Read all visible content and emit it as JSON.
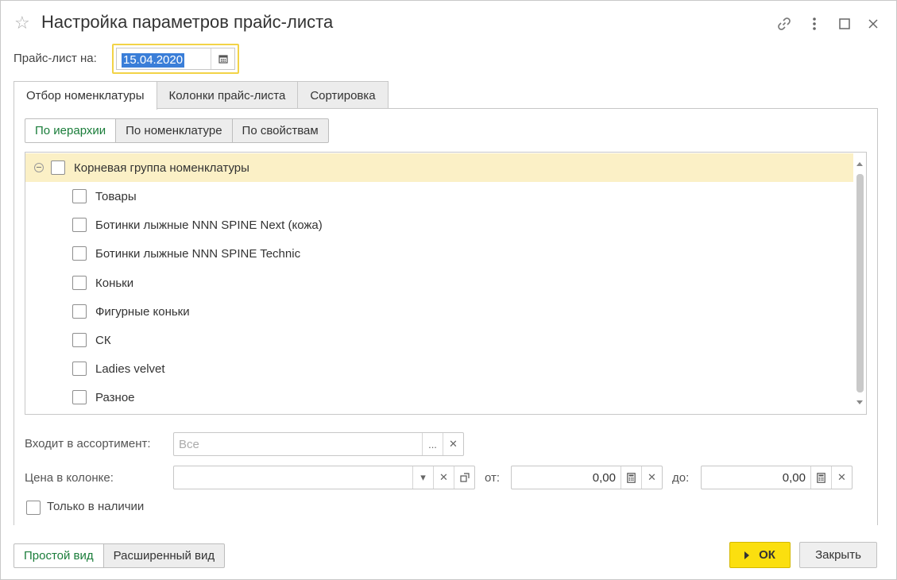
{
  "window": {
    "title": "Настройка параметров прайс-листа"
  },
  "price_date": {
    "label": "Прайс-лист на:",
    "value": "15.04.2020"
  },
  "tabs": [
    {
      "label": "Отбор номенклатуры",
      "active": true
    },
    {
      "label": "Колонки прайс-листа",
      "active": false
    },
    {
      "label": "Сортировка",
      "active": false
    }
  ],
  "filter_modes": [
    {
      "label": "По иерархии",
      "active": true
    },
    {
      "label": "По номенклатуре",
      "active": false
    },
    {
      "label": "По свойствам",
      "active": false
    }
  ],
  "tree": {
    "root": {
      "label": "Корневая группа номенклатуры",
      "checked": false
    },
    "items": [
      {
        "label": "Товары",
        "checked": false
      },
      {
        "label": "Ботинки лыжные NNN SPINE Next (кожа)",
        "checked": false
      },
      {
        "label": "Ботинки лыжные NNN SPINE Technic",
        "checked": false
      },
      {
        "label": "Коньки",
        "checked": false
      },
      {
        "label": "Фигурные коньки",
        "checked": false
      },
      {
        "label": "СК",
        "checked": false
      },
      {
        "label": "Ladies velvet",
        "checked": false
      },
      {
        "label": "Разное",
        "checked": false
      }
    ]
  },
  "filters": {
    "assortment": {
      "label": "Входит в ассортимент:",
      "placeholder": "Все"
    },
    "price_column": {
      "label": "Цена в колонке:",
      "value": ""
    },
    "from": {
      "label": "от:",
      "value": "0,00"
    },
    "to": {
      "label": "до:",
      "value": "0,00"
    },
    "only_in_stock": {
      "label": "Только в наличии",
      "checked": false
    }
  },
  "view_modes": [
    {
      "label": "Простой вид",
      "active": true
    },
    {
      "label": "Расширенный вид",
      "active": false
    }
  ],
  "buttons": {
    "ok": "ОК",
    "close": "Закрыть"
  },
  "colors": {
    "accent_green": "#1a7d3a",
    "ok_yellow": "#fbdf0f",
    "selection_row": "#fbf0c6",
    "focus_border": "#f2d347",
    "text_selection": "#3a7ed8"
  }
}
